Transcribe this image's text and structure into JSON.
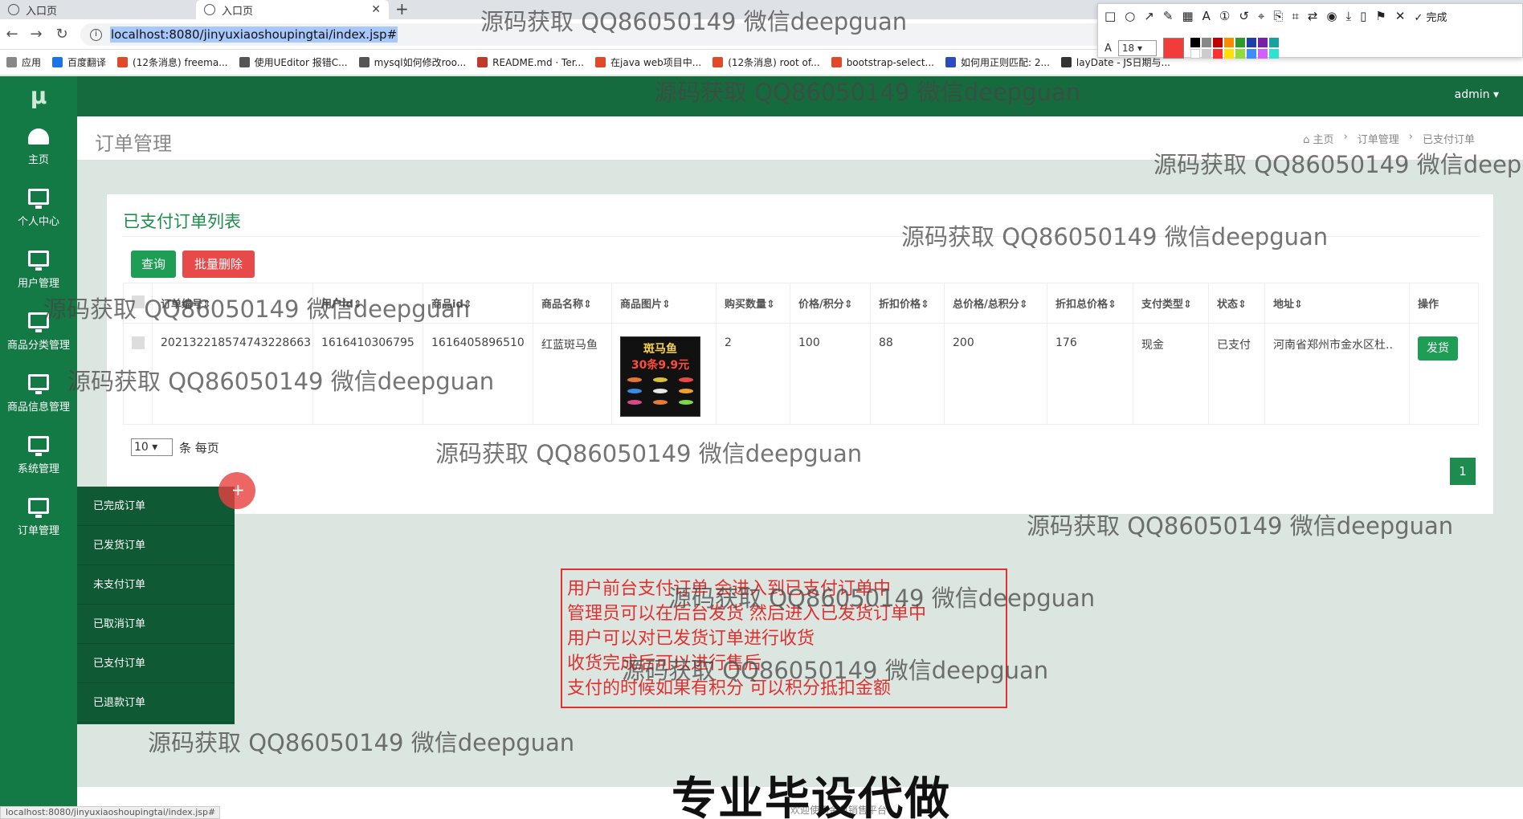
{
  "browser": {
    "tabs": [
      {
        "label": "入口页"
      },
      {
        "label": "入口页"
      }
    ],
    "url": "localhost:8080/jinyuxiaoshoupingtai/index.jsp#",
    "bookmarks": [
      "应用",
      "百度翻译",
      "(12条消息) freema...",
      "使用UEditor 报错C...",
      "mysql如何修改roo...",
      "README.md · Ter...",
      "在java web项目中...",
      "(12条消息) root of...",
      "bootstrap-select...",
      "如何用正则匹配: 2...",
      "layDate - JS日期与..."
    ],
    "bookmark_colors": [
      "#888",
      "#1a73e8",
      "#e04a2a",
      "#555",
      "#555",
      "#c0392b",
      "#e04a2a",
      "#e04a2a",
      "#e04a2a",
      "#2b4bbf",
      "#333"
    ],
    "status_url": "localhost:8080/jinyuxiaoshoupingtai/index.jsp#"
  },
  "annotation_toolbar": {
    "font_size": "18",
    "done_label": "完成",
    "current_color": "#f23c3c"
  },
  "app": {
    "logo": "μ",
    "user": "admin ▾",
    "page_title": "订单管理",
    "breadcrumb": [
      "主页",
      "订单管理",
      "已支付订单"
    ],
    "breadcrumb_sep": "›"
  },
  "sidebar": {
    "items": [
      {
        "label": "主页",
        "icon": "dashboard-icon"
      },
      {
        "label": "个人中心",
        "icon": "monitor-icon"
      },
      {
        "label": "用户管理",
        "icon": "monitor-icon"
      },
      {
        "label": "商品分类管理",
        "icon": "monitor-icon"
      },
      {
        "label": "商品信息管理",
        "icon": "monitor-icon"
      },
      {
        "label": "系统管理",
        "icon": "monitor-icon"
      },
      {
        "label": "订单管理",
        "icon": "monitor-icon"
      }
    ],
    "submenu": [
      "已完成订单",
      "已发货订单",
      "未支付订单",
      "已取消订单",
      "已支付订单",
      "已退款订单"
    ]
  },
  "panel": {
    "title": "已支付订单列表",
    "query_label": "查询",
    "batch_delete_label": "批量删除",
    "columns": [
      "订单编号⇕",
      "用户id⇕",
      "商品id⇕",
      "商品名称⇕",
      "商品图片⇕",
      "购买数量⇕",
      "价格/积分⇕",
      "折扣价格⇕",
      "总价格/总积分⇕",
      "折扣总价格⇕",
      "支付类型⇕",
      "状态⇕",
      "地址⇕",
      "操作"
    ],
    "rows": [
      {
        "order_no": "20213221857474322866​3",
        "user_id": "1616410306795",
        "goods_id": "1616405896510",
        "goods_name": "红蓝斑马鱼",
        "image_text_1": "斑马鱼",
        "image_text_2": "30条9.9元",
        "qty": "2",
        "price": "100",
        "discount_price": "88",
        "total": "200",
        "discount_total": "176",
        "pay_type": "现金",
        "status": "已支付",
        "address": "河南省郑州市金水区杜..",
        "action_label": "发货"
      }
    ],
    "page_size": "10",
    "page_size_suffix": "条 每页",
    "current_page": "1"
  },
  "note_lines": [
    "用户前台支付订单 会进入到已支付订单中",
    "管理员可以在后台发货 然后进入已发货订单中",
    "用户可以对已发货订单进行收货",
    "收货完成后可以进行售后",
    "支付的时候如果有积分 可以积分抵扣金额"
  ],
  "footer_text": "欢迎使用金鱼销售平台",
  "watermark_text": "源码获取 QQ86050149 微信deepguan",
  "banner_text": "专业毕设代做"
}
